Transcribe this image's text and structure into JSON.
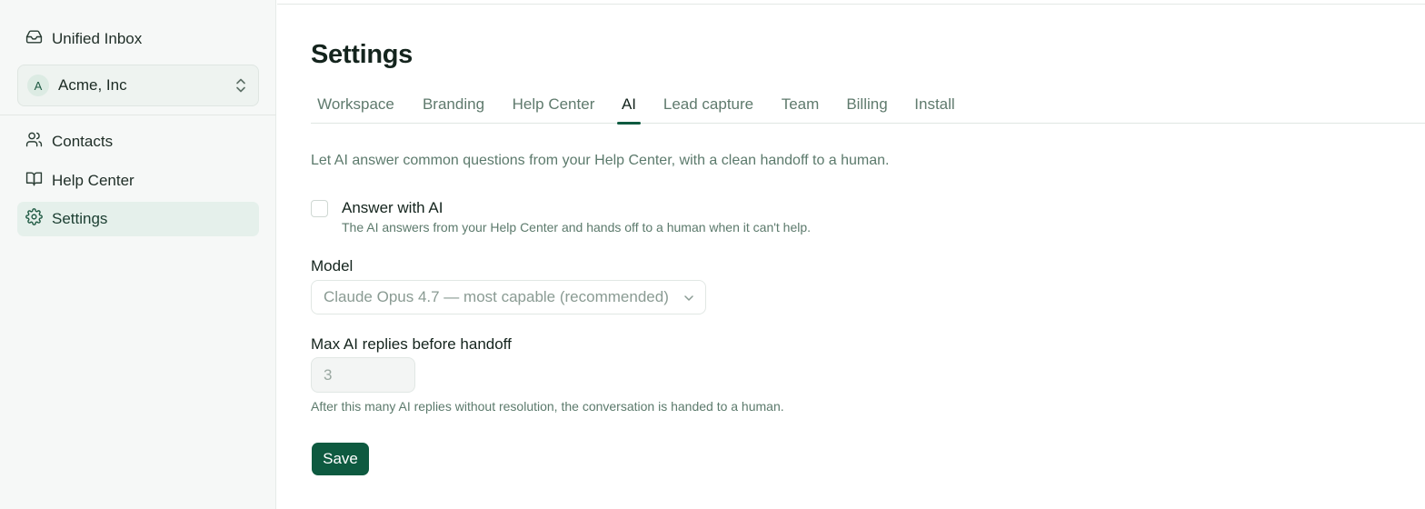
{
  "sidebar": {
    "items": [
      {
        "label": "Unified Inbox",
        "icon": "inbox-icon"
      },
      {
        "label": "Contacts",
        "icon": "users-icon"
      },
      {
        "label": "Help Center",
        "icon": "book-icon"
      },
      {
        "label": "Settings",
        "icon": "gear-icon",
        "active": true
      }
    ],
    "workspace": {
      "initial": "A",
      "name": "Acme, Inc",
      "icon": "chevron-up-down-icon"
    }
  },
  "main": {
    "title": "Settings",
    "tabs": [
      {
        "label": "Workspace"
      },
      {
        "label": "Branding"
      },
      {
        "label": "Help Center"
      },
      {
        "label": "AI",
        "active": true
      },
      {
        "label": "Lead capture"
      },
      {
        "label": "Team"
      },
      {
        "label": "Billing"
      },
      {
        "label": "Install"
      }
    ],
    "intro": "Let AI answer common questions from your Help Center, with a clean handoff to a human.",
    "answer_with_ai": {
      "label": "Answer with AI",
      "help": "The AI answers from your Help Center and hands off to a human when it can't help.",
      "checked": false
    },
    "model": {
      "label": "Model",
      "value": "Claude Opus 4.7 — most capable (recommended)",
      "icon": "chevron-down-icon"
    },
    "max_replies": {
      "label": "Max AI replies before handoff",
      "value": "3",
      "help": "After this many AI replies without resolution, the conversation is handed to a human."
    },
    "save_label": "Save"
  },
  "colors": {
    "accent": "#0e5a40",
    "sidebar_bg": "#f6f8f7",
    "active_item_bg": "#e5f0eb",
    "muted_text": "#5c7a6c"
  }
}
